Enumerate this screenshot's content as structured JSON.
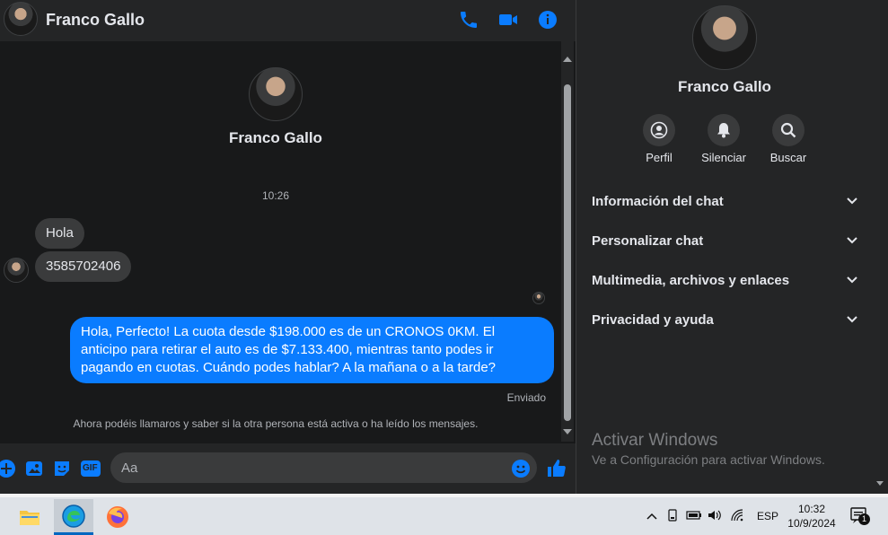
{
  "header": {
    "contact_name": "Franco Gallo"
  },
  "conversation": {
    "profile_name": "Franco Gallo",
    "timestamp": "10:26",
    "incoming": [
      "Hola",
      "3585702406"
    ],
    "outgoing": "Hola, Perfecto! La cuota desde $198.000 es de un CRONOS 0KM. El anticipo para retirar el auto es de $7.133.400, mientras tanto podes ir pagando en cuotas. Cuándo podes hablar? A la mañana o a la tarde?",
    "status": "Enviado",
    "notice": "Ahora podéis llamaros y saber si la otra persona está activa o ha leído los mensajes."
  },
  "composer": {
    "placeholder": "Aa",
    "gif_label": "GIF"
  },
  "panel": {
    "name": "Franco Gallo",
    "actions": [
      {
        "label": "Perfil",
        "icon": "profile-icon"
      },
      {
        "label": "Silenciar",
        "icon": "bell-icon"
      },
      {
        "label": "Buscar",
        "icon": "search-icon"
      }
    ],
    "sections": [
      "Información del chat",
      "Personalizar chat",
      "Multimedia, archivos y enlaces",
      "Privacidad y ayuda"
    ],
    "activate_title": "Activar Windows",
    "activate_subtitle": "Ve a Configuración para activar Windows."
  },
  "taskbar": {
    "language": "ESP",
    "time": "10:32",
    "date": "10/9/2024",
    "notification_count": "1"
  },
  "colors": {
    "accent": "#0a7cff",
    "background": "#18191a",
    "surface": "#242526"
  }
}
